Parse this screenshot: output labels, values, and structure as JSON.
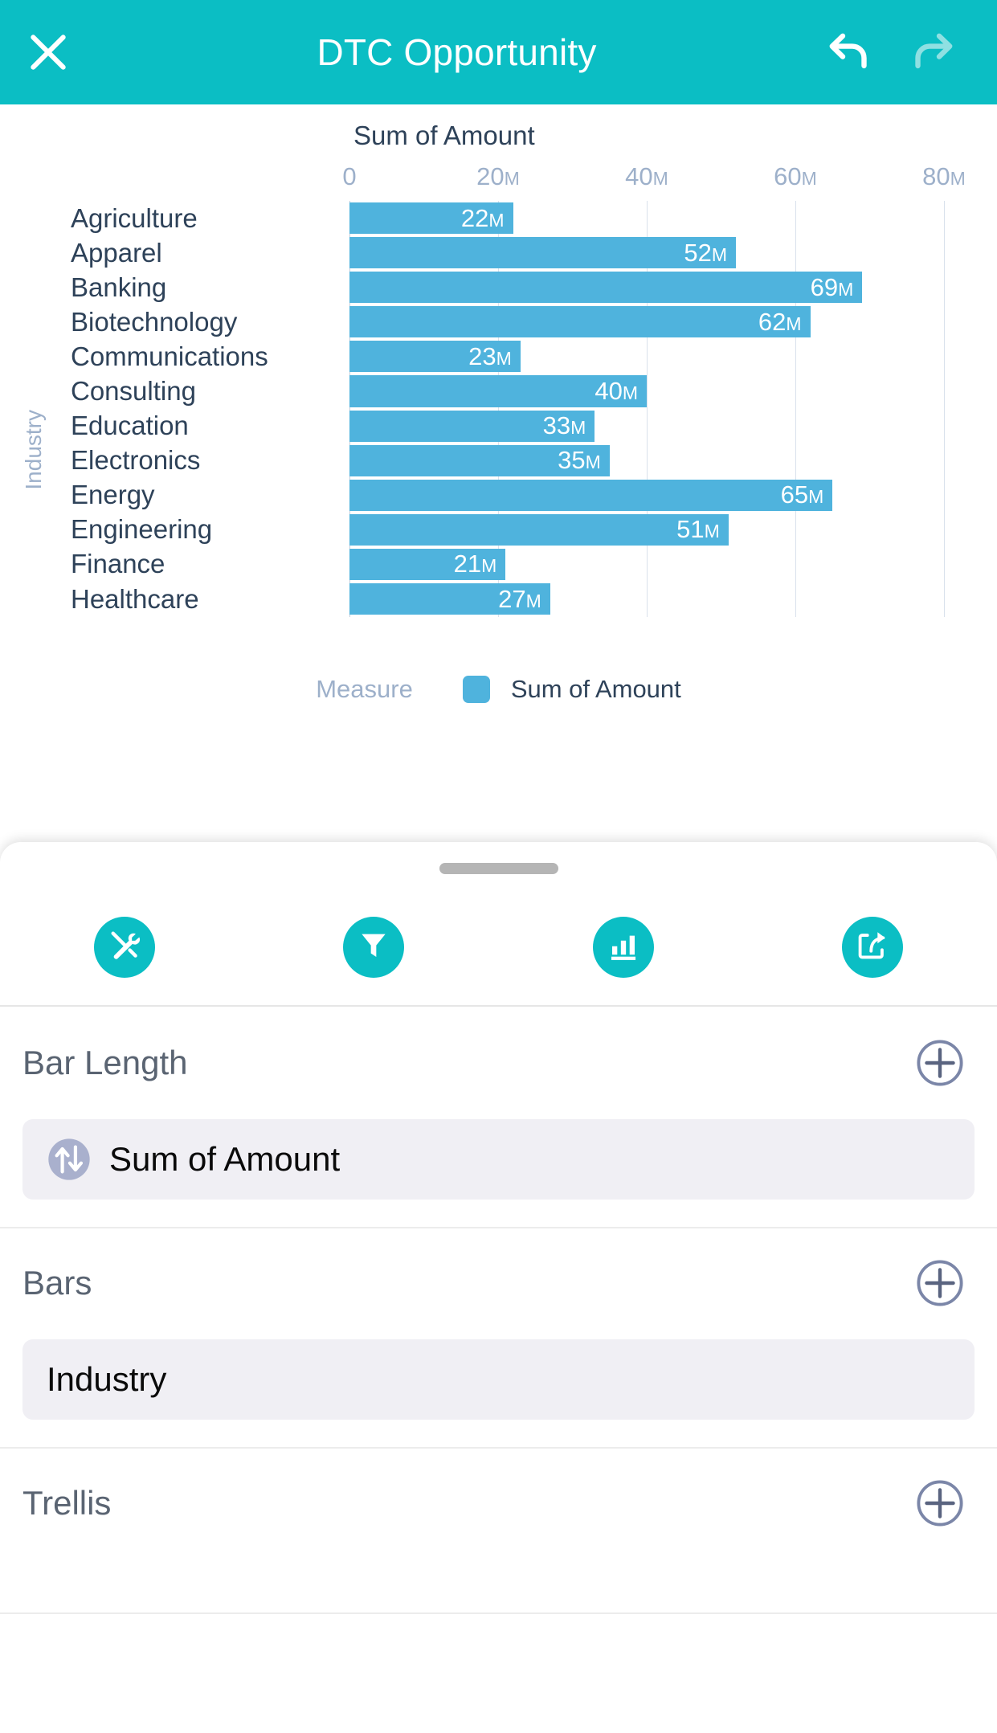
{
  "header": {
    "title": "DTC Opportunity",
    "close_icon": "close-icon",
    "undo_icon": "undo-icon",
    "redo_icon": "redo-icon"
  },
  "chart_data": {
    "type": "bar",
    "orientation": "horizontal",
    "title": "Sum of Amount",
    "xlabel": "Sum of Amount",
    "ylabel": "Industry",
    "xlim": [
      0,
      80000000
    ],
    "x_ticks": [
      0,
      20000000,
      40000000,
      60000000,
      80000000
    ],
    "x_tick_labels": [
      "0",
      "20M",
      "40M",
      "60M",
      "80M"
    ],
    "grid": true,
    "bar_color": "#4fb3dd",
    "legend": {
      "position": "bottom",
      "title": "Measure",
      "entries": [
        "Sum of Amount"
      ]
    },
    "categories": [
      "Agriculture",
      "Apparel",
      "Banking",
      "Biotechnology",
      "Communications",
      "Consulting",
      "Education",
      "Electronics",
      "Energy",
      "Engineering",
      "Finance",
      "Healthcare"
    ],
    "values": [
      22,
      52,
      69,
      62,
      23,
      40,
      33,
      35,
      65,
      51,
      21,
      27
    ],
    "value_labels": [
      "22M",
      "52M",
      "69M",
      "62M",
      "23M",
      "40M",
      "33M",
      "35M",
      "65M",
      "51M",
      "21M",
      "27M"
    ],
    "series": [
      {
        "name": "Sum of Amount",
        "values": [
          22,
          52,
          69,
          62,
          23,
          40,
          33,
          35,
          65,
          51,
          21,
          27
        ]
      }
    ]
  },
  "sheet": {
    "toolbar": [
      {
        "name": "tools-icon",
        "label": "Tools"
      },
      {
        "name": "filter-icon",
        "label": "Filters"
      },
      {
        "name": "chart-icon",
        "label": "Chart"
      },
      {
        "name": "share-icon",
        "label": "Share"
      }
    ],
    "sections": [
      {
        "title": "Bar Length",
        "add_label": "+",
        "chips": [
          {
            "label": "Sum of Amount",
            "icon": "measure-icon"
          }
        ]
      },
      {
        "title": "Bars",
        "add_label": "+",
        "chips": [
          {
            "label": "Industry",
            "icon": null
          }
        ]
      },
      {
        "title": "Trellis",
        "add_label": "+",
        "chips": []
      }
    ]
  },
  "colors": {
    "brand_teal": "#0bbec4",
    "bar_blue": "#4fb3dd",
    "text_dark": "#2e4259",
    "axis_gray": "#9db0ca",
    "chip_bg": "#f0eff4"
  }
}
